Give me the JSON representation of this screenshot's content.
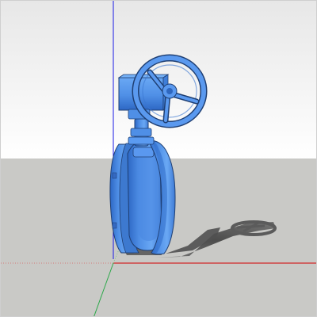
{
  "viewport": {
    "label": "",
    "colors": {
      "sky_top": "#e7e7e7",
      "sky_bottom": "#ffffff",
      "ground": "#c9c9c6",
      "model_main": "#4f8fe6",
      "model_light": "#6aa8f4",
      "model_dark": "#2d67c4",
      "outline": "#1f3f73",
      "shadow": "#4b4b4b",
      "axis_red": "#d20000",
      "axis_blue": "#1a1ae6",
      "axis_green": "#2ca84a"
    }
  },
  "scene": {
    "model_name": "",
    "camera": "",
    "icons": [
      "sketchup-viewport",
      "valve-model",
      "shadow",
      "red-axis-icon",
      "blue-axis-icon",
      "green-axis-icon"
    ]
  }
}
